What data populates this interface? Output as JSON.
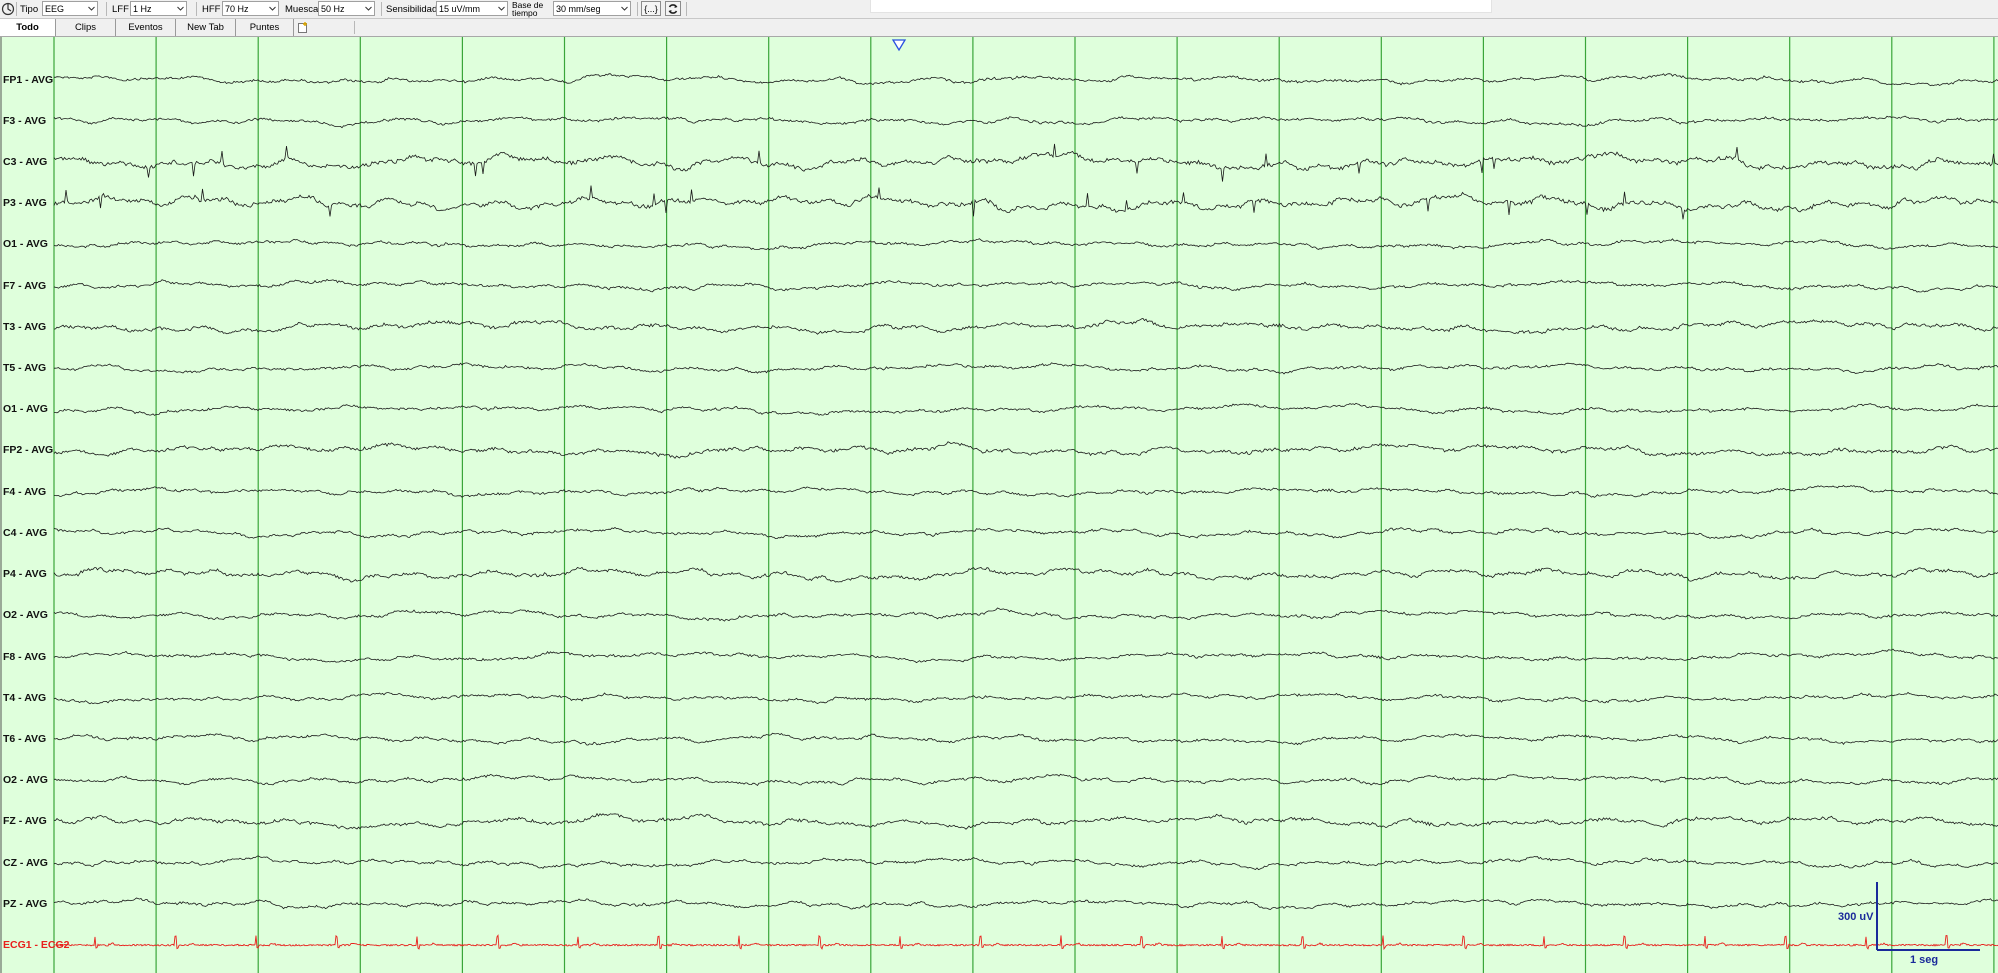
{
  "toolbar": {
    "tipo_label": "Tipo",
    "tipo_value": "EEG",
    "lff_label": "LFF",
    "lff_value": "1 Hz",
    "hff_label": "HFF",
    "hff_value": "70 Hz",
    "muesca_label": "Muesca",
    "muesca_value": "50 Hz",
    "sensibilidad_label": "Sensibilidad",
    "sensibilidad_value": "15 uV/mm",
    "base_label_line1": "Base de",
    "base_label_line2": "tiempo",
    "base_value": "30 mm/seg",
    "brackets_button": "{...}"
  },
  "tabs": [
    "Todo",
    "Clips",
    "Eventos",
    "New Tab",
    "Puntes"
  ],
  "active_tab": "Todo",
  "channels": [
    {
      "label": "FP1 - AVG",
      "kind": "eeg",
      "activity": "low"
    },
    {
      "label": "F3 - AVG",
      "kind": "eeg",
      "activity": "low"
    },
    {
      "label": "C3 - AVG",
      "kind": "eeg",
      "activity": "high"
    },
    {
      "label": "P3 - AVG",
      "kind": "eeg",
      "activity": "high"
    },
    {
      "label": "O1 - AVG",
      "kind": "eeg",
      "activity": "low"
    },
    {
      "label": "F7 - AVG",
      "kind": "eeg",
      "activity": "low"
    },
    {
      "label": "T3 - AVG",
      "kind": "eeg",
      "activity": "medium"
    },
    {
      "label": "T5 - AVG",
      "kind": "eeg",
      "activity": "low"
    },
    {
      "label": "O1 - AVG",
      "kind": "eeg",
      "activity": "low"
    },
    {
      "label": "FP2 - AVG",
      "kind": "eeg",
      "activity": "medium"
    },
    {
      "label": "F4 - AVG",
      "kind": "eeg",
      "activity": "low"
    },
    {
      "label": "C4 - AVG",
      "kind": "eeg",
      "activity": "low"
    },
    {
      "label": "P4 - AVG",
      "kind": "eeg",
      "activity": "medium"
    },
    {
      "label": "O2 - AVG",
      "kind": "eeg",
      "activity": "low"
    },
    {
      "label": "F8 - AVG",
      "kind": "eeg",
      "activity": "low"
    },
    {
      "label": "T4 - AVG",
      "kind": "eeg",
      "activity": "low"
    },
    {
      "label": "T6 - AVG",
      "kind": "eeg",
      "activity": "low"
    },
    {
      "label": "O2 - AVG",
      "kind": "eeg",
      "activity": "low"
    },
    {
      "label": "FZ - AVG",
      "kind": "eeg",
      "activity": "medium"
    },
    {
      "label": "CZ - AVG",
      "kind": "eeg",
      "activity": "low"
    },
    {
      "label": "PZ - AVG",
      "kind": "eeg",
      "activity": "low"
    },
    {
      "label": "ECG1 - ECG2",
      "kind": "ecg",
      "activity": "ecg"
    }
  ],
  "seconds_shown": 20,
  "scale_bar": {
    "voltage": "300 uV",
    "time": "1 seg"
  },
  "colors": {
    "background": "#dfffdc",
    "second_line": "#3aa53a",
    "trace": "#1a1a1a",
    "ecg_trace": "#e8201c",
    "marker": "#2850e0",
    "scale": "#1a2a9a"
  }
}
